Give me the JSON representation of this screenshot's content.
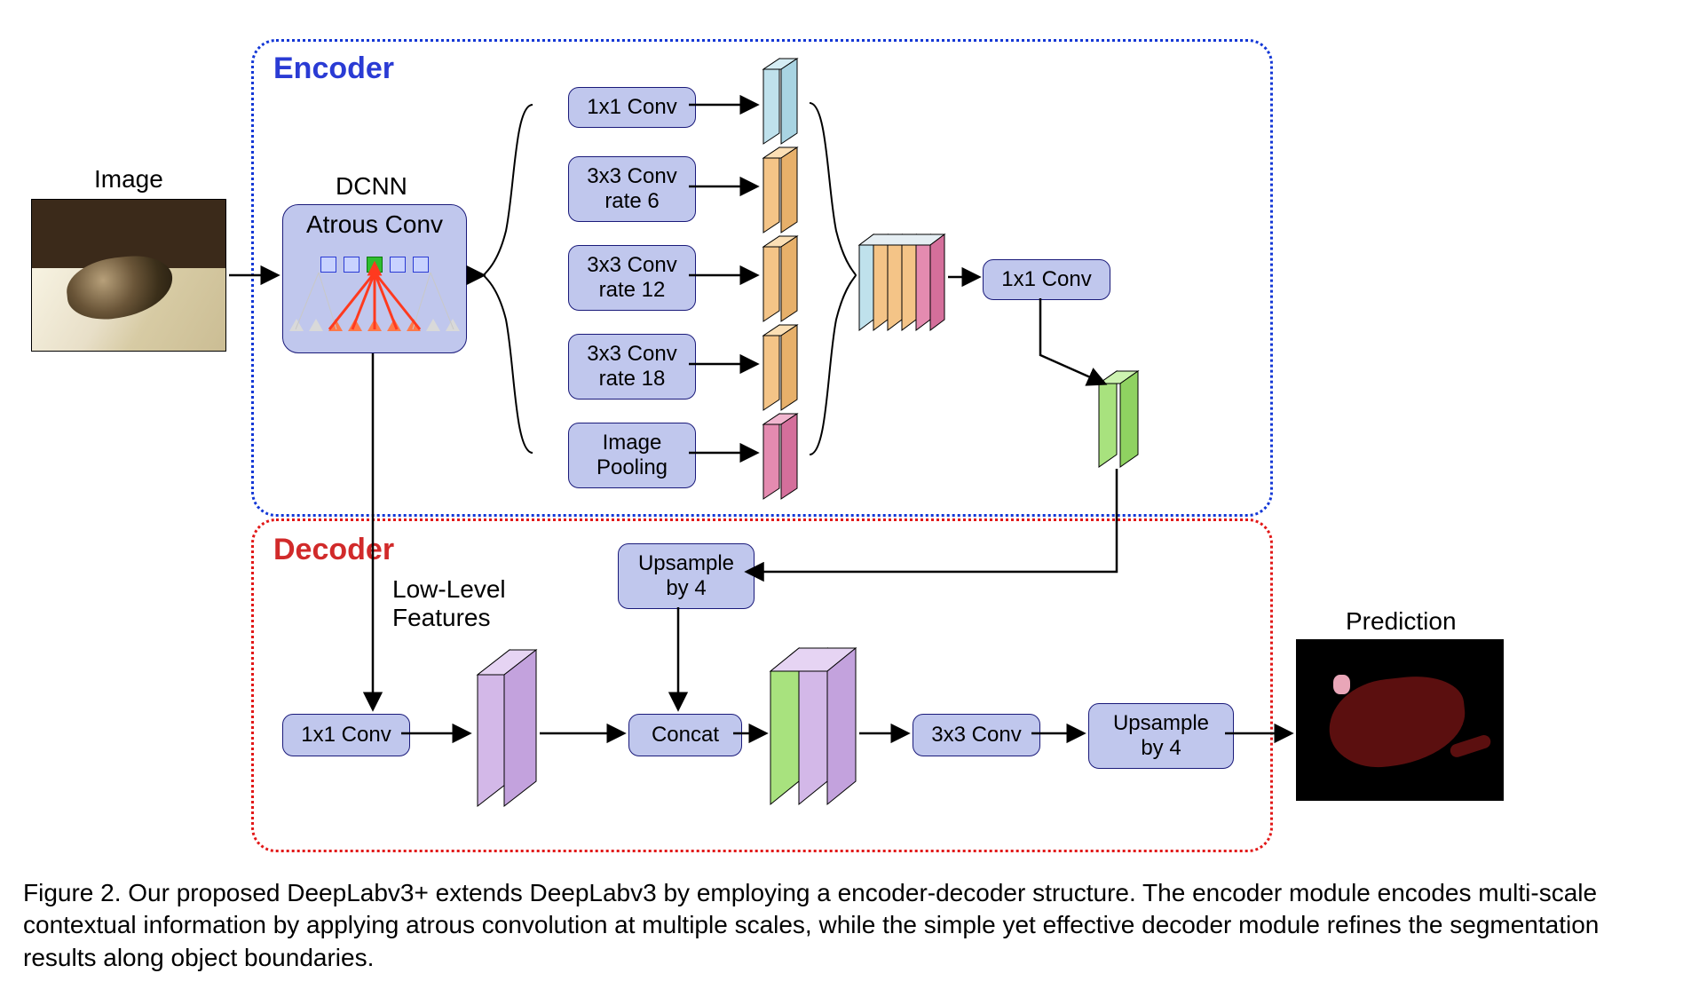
{
  "labels": {
    "image": "Image",
    "dcnn": "DCNN",
    "atrous": "Atrous Conv",
    "encoder": "Encoder",
    "decoder": "Decoder",
    "lowlevel_top": "Low-Level",
    "lowlevel_bot": "Features",
    "prediction": "Prediction"
  },
  "aspp": {
    "b1": "1x1 Conv",
    "b2_l1": "3x3 Conv",
    "b2_l2": "rate 6",
    "b3_l1": "3x3 Conv",
    "b3_l2": "rate 12",
    "b4_l1": "3x3 Conv",
    "b4_l2": "rate 18",
    "b5_l1": "Image",
    "b5_l2": "Pooling"
  },
  "enc": {
    "conv1x1": "1x1 Conv"
  },
  "dec": {
    "conv1x1": "1x1 Conv",
    "up4a_l1": "Upsample",
    "up4a_l2": "by 4",
    "concat": "Concat",
    "conv3x3": "3x3 Conv",
    "up4b_l1": "Upsample",
    "up4b_l2": "by 4"
  },
  "caption": "Figure 2. Our proposed DeepLabv3+ extends DeepLabv3 by employing a encoder-decoder structure. The encoder module encodes multi-scale contextual information by applying atrous convolution at multiple scales, while the simple yet effective decoder module refines the segmentation results along object boundaries.",
  "diagram_semantics": {
    "architecture": "DeepLabv3+",
    "encoder": {
      "backbone": "DCNN with Atrous Convolution",
      "aspp_branches": [
        {
          "op": "1x1 Conv"
        },
        {
          "op": "3x3 Conv",
          "dilation_rate": 6
        },
        {
          "op": "3x3 Conv",
          "dilation_rate": 12
        },
        {
          "op": "3x3 Conv",
          "dilation_rate": 18
        },
        {
          "op": "Image Pooling"
        }
      ],
      "aspp_merge": "concat -> 1x1 Conv"
    },
    "decoder": {
      "low_level_projection": "1x1 Conv on backbone low-level features",
      "steps": [
        "Upsample encoder output by 4",
        "Concat with projected low-level features",
        "3x3 Conv",
        "Upsample by 4"
      ],
      "output": "Prediction (segmentation mask)"
    }
  }
}
